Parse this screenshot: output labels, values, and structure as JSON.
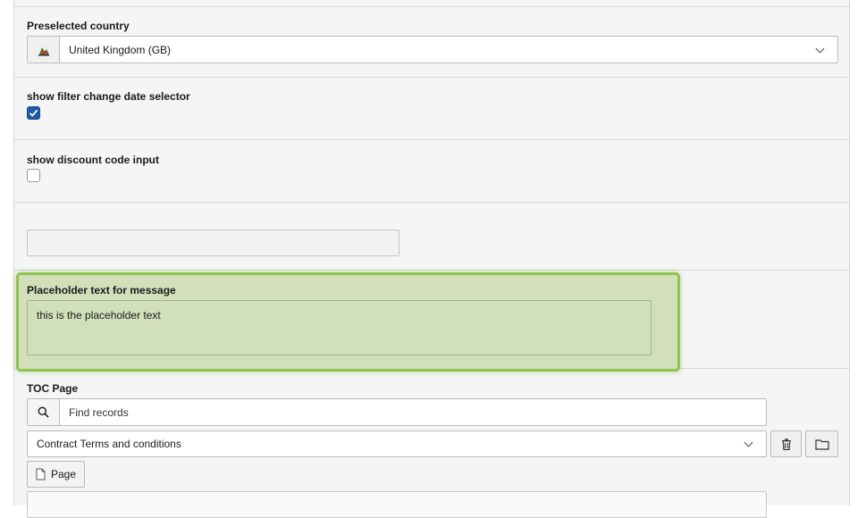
{
  "country": {
    "label": "Preselected country",
    "value": "United Kingdom (GB)",
    "icon": "country-flag-icon"
  },
  "filter_date": {
    "label": "show filter change date selector",
    "checked": true
  },
  "discount": {
    "label": "show discount code input",
    "checked": false
  },
  "message_placeholder": {
    "label": "Placeholder text for message",
    "value": "this is the placeholder text",
    "highlight_color": "#8dc44f"
  },
  "toc_page": {
    "label": "TOC Page",
    "search_placeholder": "Find records",
    "selected": "Contract Terms and conditions",
    "page_button_label": "Page"
  },
  "colors": {
    "checkbox_checked": "#1f5aa6",
    "panel_bg": "#f5f5f5"
  }
}
